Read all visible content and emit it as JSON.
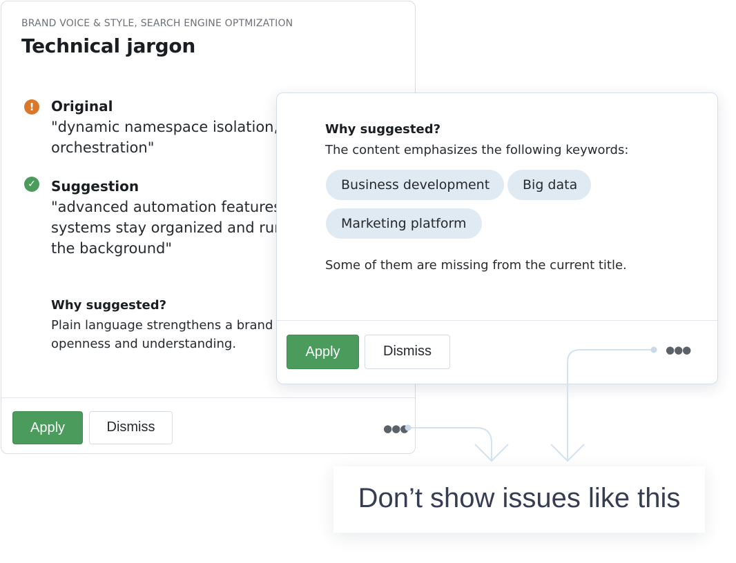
{
  "left_card": {
    "category": "BRAND VOICE & STYLE, SEARCH ENGINE OPTMIZATION",
    "title": "Technical jargon",
    "original": {
      "icon": "warning-icon",
      "label": "Original",
      "lines": [
        "\"dynamic namespace isolation,",
        "orchestration\""
      ]
    },
    "suggestion": {
      "icon": "check-icon",
      "label": "Suggestion",
      "lines": [
        "\"advanced automation features",
        "systems stay organized and run",
        "the background\""
      ]
    },
    "why": {
      "label": "Why suggested?",
      "lines": [
        "Plain language strengthens a brand",
        "openness and understanding."
      ]
    },
    "actions": {
      "apply": "Apply",
      "dismiss": "Dismiss"
    }
  },
  "right_card": {
    "why_label": "Why suggested?",
    "intro": "The content emphasizes the following keywords:",
    "keywords": [
      "Business development",
      "Big data",
      "Marketing platform"
    ],
    "note": "Some of them are missing from the current title.",
    "actions": {
      "apply": "Apply",
      "dismiss": "Dismiss"
    }
  },
  "popup": {
    "text": "Don’t show issues like this"
  },
  "colors": {
    "accent_green": "#4a9b5c",
    "warning_orange": "#d9772b",
    "chip_bg": "#dfeaf2",
    "connector": "#d3e2ef"
  }
}
